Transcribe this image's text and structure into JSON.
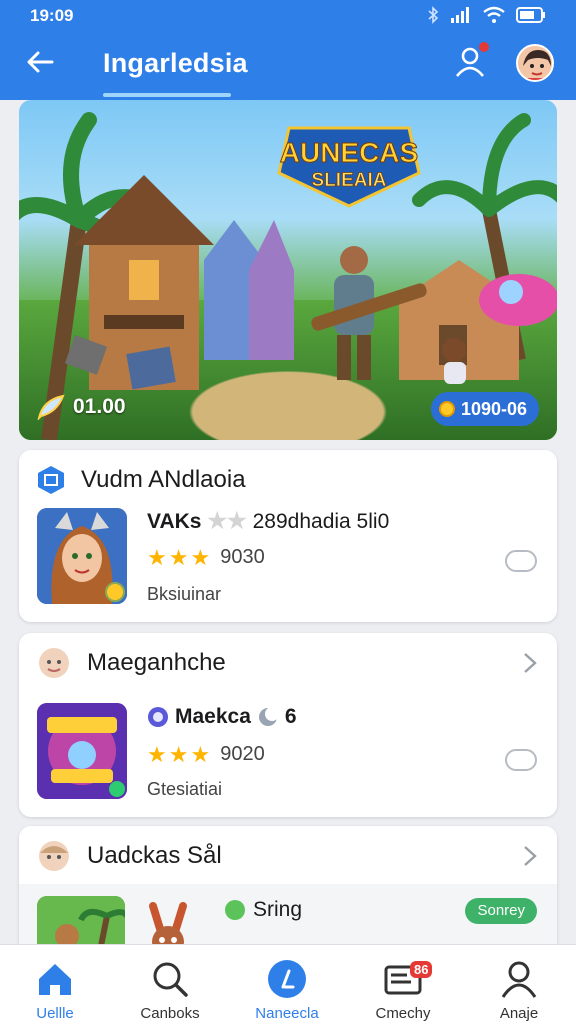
{
  "status_bar": {
    "time": "19:09"
  },
  "header": {
    "title": "Ingarledsia"
  },
  "hero": {
    "logo_line1": "AUNECAS",
    "logo_line2": "SLIEAIA",
    "left_value": "01.00",
    "right_value": "1090-06"
  },
  "cards": [
    {
      "heading": "Vudm ANdlaoia",
      "item_title": "VAKs",
      "item_title_suffix": "289dhadia 5li0",
      "stars_filled": 3,
      "rating_value": "9030",
      "subtitle": "Bksiuinar"
    },
    {
      "heading": "Maeganhche",
      "item_title": "Maekca",
      "item_title_suffix": "6",
      "stars_filled": 3,
      "rating_value": "9020",
      "subtitle": "Gtesiatiai"
    },
    {
      "heading": "Uadckas Sål",
      "item_title": "Sring",
      "pill": "Sonrey"
    }
  ],
  "bottom_nav": [
    {
      "label": "Uellle",
      "icon": "home-icon",
      "active": true
    },
    {
      "label": "Canboks",
      "icon": "search-icon",
      "active": false
    },
    {
      "label": "Naneecla",
      "icon": "music-icon",
      "active": false
    },
    {
      "label": "Cmechy",
      "icon": "mail-icon",
      "active": false,
      "badge": "86"
    },
    {
      "label": "Anaje",
      "icon": "profile-icon",
      "active": false
    }
  ],
  "colors": {
    "primary": "#2f7fe8",
    "star": "#ffb400",
    "pill": "#3fb26a",
    "badge": "#e53935"
  }
}
